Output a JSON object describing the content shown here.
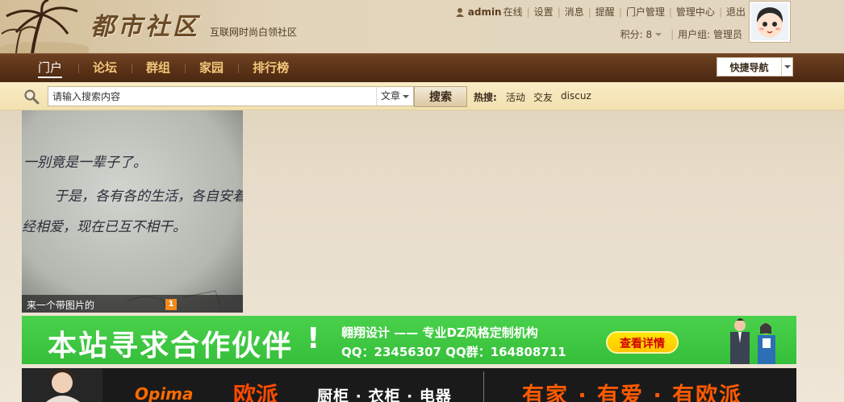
{
  "header": {
    "logo": "都市社区",
    "tagline": "互联网时尚白领社区",
    "user": {
      "name": "admin",
      "status": "在线",
      "links": [
        "设置",
        "消息",
        "提醒",
        "门户管理",
        "管理中心",
        "退出"
      ]
    },
    "credits_label": "积分: 8",
    "usergroup_label": "用户组: 管理员"
  },
  "nav": {
    "items": [
      "门户",
      "论坛",
      "群组",
      "家园",
      "排行榜"
    ],
    "active_index": 0,
    "quicknav_label": "快捷导航"
  },
  "search": {
    "placeholder": "请输入搜索内容",
    "type": "文章",
    "button": "搜索",
    "hot_label": "热搜:",
    "hot_links": [
      "活动",
      "交友",
      "discuz"
    ]
  },
  "slide": {
    "caption": "来一个带图片的",
    "page": "1",
    "handwriting": [
      "一别竟是一辈子了。",
      "于是，各有各的生活，各自安着别自",
      "经相爱，现在已互不相干。"
    ]
  },
  "ad_green": {
    "headline": "本站寻求合作伙伴",
    "bang": "!",
    "sub": "翱翔设计 —— 专业DZ风格定制机构",
    "contact": "QQ：23456307  QQ群：164808711",
    "button": "查看详情"
  },
  "ad_black": {
    "brand_en": "Opima",
    "brand_cn": "欧派",
    "products": "厨柜 · 衣柜 · 电器",
    "slogan": "有家 · 有爱 · 有欧派"
  },
  "colors": {
    "nav_bg": "#5a3217",
    "nav_text": "#f3c77a",
    "search_bg": "#f6e8bb",
    "ad_green": "#3ec942",
    "ad_orange": "#ff5a00"
  }
}
